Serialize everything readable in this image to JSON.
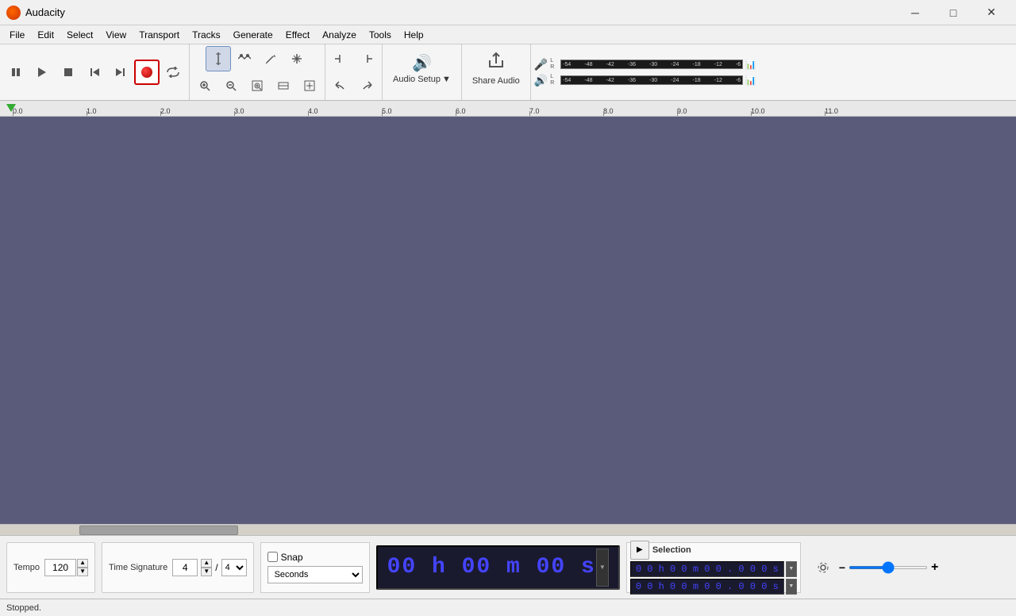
{
  "app": {
    "title": "Audacity",
    "icon": "audacity-icon"
  },
  "window_controls": {
    "minimize": "─",
    "maximize": "□",
    "close": "✕"
  },
  "menu": {
    "items": [
      "File",
      "Edit",
      "Select",
      "View",
      "Transport",
      "Tracks",
      "Generate",
      "Effect",
      "Analyze",
      "Tools",
      "Help"
    ]
  },
  "toolbar": {
    "transport": {
      "pause": "⏸",
      "play": "▶",
      "stop": "■",
      "skip_start": "⏮",
      "skip_end": "⏭",
      "record": "●",
      "loop": "↩"
    },
    "tools": {
      "select": "I",
      "envelope": "↔",
      "draw": "✏",
      "multi": "✱",
      "zoom_in": "+",
      "zoom_out": "-",
      "zoom_sel": "⊞",
      "zoom_fit": "⊡",
      "zoom_width": "⊠"
    },
    "edit": {
      "trim": "⊢",
      "silence": "⊣",
      "undo": "↩",
      "redo": "↪"
    },
    "audio_setup": {
      "icon": "speaker-icon",
      "label": "Audio Setup",
      "arrow": "▼"
    },
    "share_audio": {
      "icon": "share-icon",
      "label": "Share Audio"
    }
  },
  "vu_meters": {
    "input": {
      "icon": "🎤",
      "lr": "LR",
      "labels": [
        "-54",
        "-48",
        "-42",
        "-36",
        "-30",
        "-24",
        "-18",
        "-12",
        "-6"
      ]
    },
    "output": {
      "icon": "🔊",
      "lr": "LR",
      "labels": [
        "-54",
        "-48",
        "-42",
        "-36",
        "-30",
        "-24",
        "-18",
        "-12",
        "-6"
      ]
    }
  },
  "ruler": {
    "marks": [
      "0.0",
      "1.0",
      "2.0",
      "3.0",
      "4.0",
      "5.0",
      "6.0",
      "7.0",
      "8.0",
      "9.0",
      "10.0",
      "11.0"
    ]
  },
  "bottom": {
    "tempo": {
      "label": "Tempo",
      "value": "120"
    },
    "time_signature": {
      "label": "Time Signature",
      "numerator": "4",
      "denominator": "4"
    },
    "snap": {
      "checkbox_label": "Snap",
      "dropdown_value": "Seconds",
      "checked": false
    },
    "time_display": {
      "value": "00 h 00 m 00 s"
    },
    "selection": {
      "label": "Selection",
      "start": "0 0 h 0 0 m 0 0 . 0 0 0 s",
      "end": "0 0 h 0 0 m 0 0 . 0 0 0 s"
    },
    "playback": {
      "play_icon": "▶"
    },
    "volume_slider": {
      "min_icon": "−",
      "max_icon": "+"
    }
  },
  "status": {
    "text": "Stopped."
  }
}
